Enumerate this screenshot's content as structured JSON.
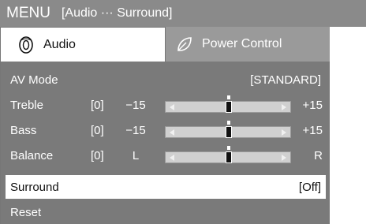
{
  "title": {
    "menu": "MENU",
    "breadcrumb": "[Audio ··· Surround]"
  },
  "tabs": [
    {
      "label": "Audio",
      "active": true,
      "icon": "speaker-icon"
    },
    {
      "label": "Power Control",
      "active": false,
      "icon": "leaf-icon"
    }
  ],
  "rows": {
    "av_mode": {
      "label": "AV Mode",
      "value": "[STANDARD]"
    },
    "treble": {
      "label": "Treble",
      "value": "[0]",
      "min": "−15",
      "max": "+15",
      "level": 0
    },
    "bass": {
      "label": "Bass",
      "value": "[0]",
      "min": "−15",
      "max": "+15",
      "level": 0
    },
    "balance": {
      "label": "Balance",
      "value": "[0]",
      "min": "L",
      "max": "R",
      "level": 0
    },
    "surround": {
      "label": "Surround",
      "value": "[Off]"
    },
    "reset": {
      "label": "Reset"
    }
  },
  "colors": {
    "header": "#8a8a8a",
    "panel": "#7a7a7a",
    "selected": "#ffffff"
  }
}
